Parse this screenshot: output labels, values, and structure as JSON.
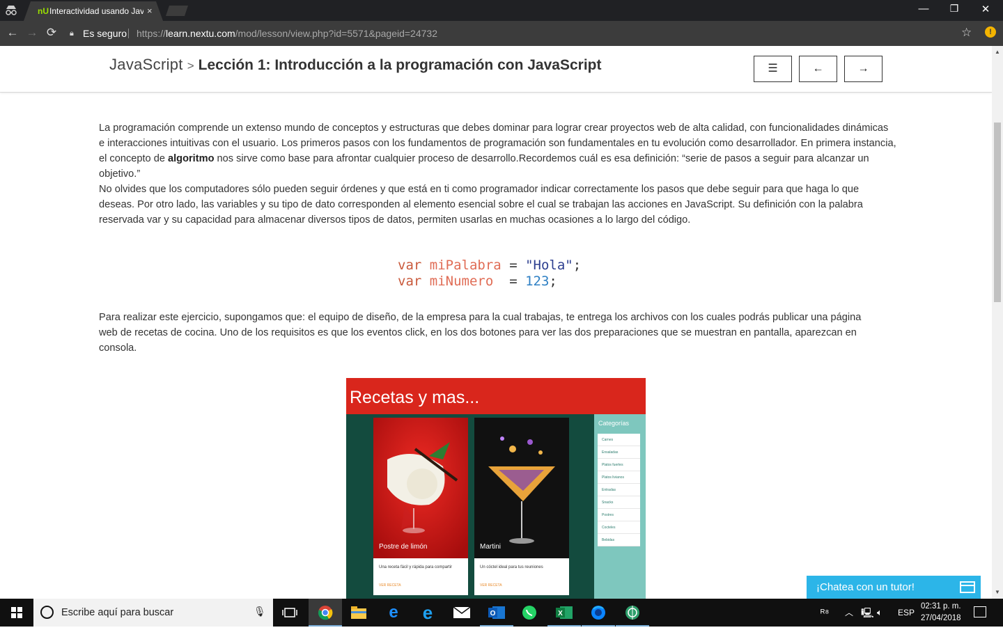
{
  "browser": {
    "tab_title": "Interactividad usando JavaScript",
    "tab_close": "×",
    "secure_label": "Es seguro",
    "url_scheme": "https://",
    "url_host": "learn.nextu.com",
    "url_path": "/mod/lesson/view.php?id=5571&pageid=24732",
    "window_controls": [
      "—",
      "❐",
      "✕"
    ]
  },
  "lesson": {
    "course": "JavaScript",
    "separator": ">",
    "title": "Lección 1: Introducción a la programación con JavaScript",
    "menu_button": "☰",
    "prev_button": "←",
    "next_button": "→"
  },
  "content": {
    "p1_a": "La programación comprende un extenso mundo de conceptos y estructuras que debes dominar para lograr crear proyectos web de alta calidad, con funcionalidades dinámicas e interacciones intuitivas con el usuario. Los primeros pasos con los fundamentos de programación son fundamentales en tu evolución como desarrollador. En primera instancia, el concepto de ",
    "p1_bold": "algoritmo",
    "p1_b": " nos sirve como base para afrontar cualquier proceso de desarrollo.Recordemos cuál es esa definición: “serie de pasos a seguir para alcanzar un objetivo.”",
    "p2": "No olvides que los computadores sólo pueden seguir órdenes y que está en ti como programador indicar correctamente los pasos que debe seguir para que haga lo que deseas. Por otro lado, las variables y su tipo de dato corresponden al elemento esencial sobre el cual se trabajan las acciones en JavaScript. Su definición con la palabra reservada var y su capacidad para almacenar diversos tipos de datos, permiten usarlas en muchas ocasiones a lo largo del código.",
    "code": {
      "line1": {
        "kw": "var",
        "name": "miPalabra",
        "op": "=",
        "value": "\"Hola\"",
        "end": ";"
      },
      "line2": {
        "kw": "var",
        "name": "miNumero",
        "op": "=",
        "value": "123",
        "end": ";"
      }
    },
    "p3": "Para realizar este ejercicio, supongamos que: el equipo de diseño, de la empresa para la cual trabajas, te entrega los archivos con los cuales podrás publicar una página web de recetas de cocina. Uno de los requisitos es que los eventos click, en los dos botones para ver las dos preparaciones que se muestran en pantalla, aparezcan en consola."
  },
  "embedded_image": {
    "header": "Recetas y mas...",
    "cards": [
      {
        "caption": "Postre de limón",
        "desc": "Una receta fácil y rápida para compartir",
        "link": "VER RECETA"
      },
      {
        "caption": "Martini",
        "desc": "Un cóctel ideal para tus reuniones",
        "link": "VER RECETA"
      }
    ],
    "sidebar_title": "Categorías",
    "categories": [
      "Carnes",
      "Ensaladas",
      "Platos fuertes",
      "Platos livianos",
      "Entradas",
      "Snacks",
      "Postres",
      "Cocteles",
      "Bebidas"
    ]
  },
  "chat": {
    "label": "¡Chatea con un tutor!"
  },
  "taskbar": {
    "search_placeholder": "Escribe aquí para buscar",
    "language": "ESP",
    "time": "02:31 p. m.",
    "date": "27/04/2018"
  },
  "colors": {
    "accent_chat": "#2cb5e8",
    "recipe_header": "#d9261c",
    "recipe_bg": "#134b3e",
    "recipe_sidebar": "#7ec7be"
  }
}
